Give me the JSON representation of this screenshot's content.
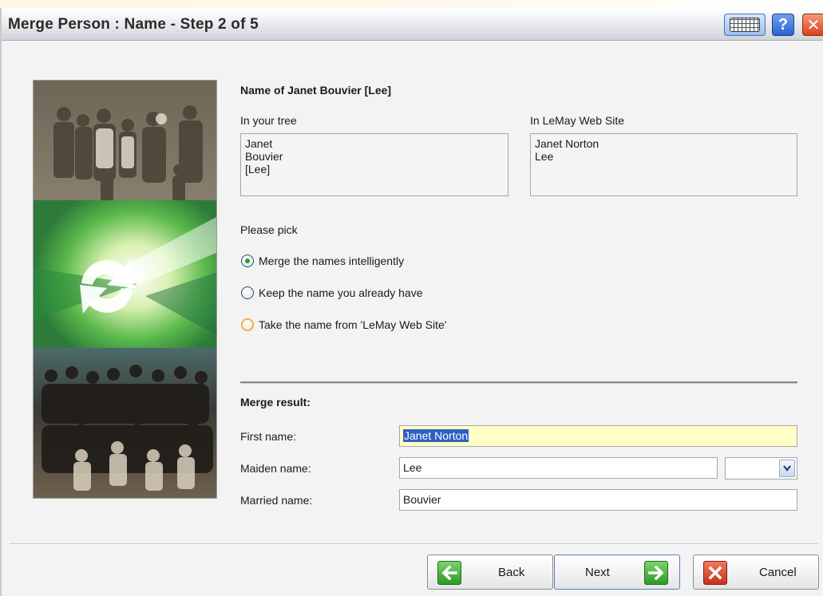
{
  "window": {
    "title": "Merge Person : Name - Step 2 of 5"
  },
  "titlebar_buttons": {
    "keyboard_icon": "keyboard-icon",
    "help_label": "?",
    "close_label": "✕"
  },
  "heading": "Name of Janet Bouvier [Lee]",
  "tree": {
    "label": "In your tree",
    "lines": [
      "Janet",
      "Bouvier",
      "[Lee]"
    ]
  },
  "site": {
    "label": "In LeMay Web Site",
    "lines": [
      "Janet Norton",
      "Lee"
    ]
  },
  "pick": {
    "label": "Please pick",
    "options": [
      {
        "label": "Merge the names intelligently",
        "checked": true
      },
      {
        "label": "Keep the name you already have",
        "checked": false
      },
      {
        "label": "Take the name from 'LeMay Web Site'",
        "checked": false
      }
    ]
  },
  "result": {
    "label": "Merge result:",
    "first_name_label": "First name:",
    "first_name_value": "Janet Norton",
    "maiden_name_label": "Maiden name:",
    "maiden_name_value": "Lee",
    "maiden_dropdown_value": "",
    "married_name_label": "Married name:",
    "married_name_value": "Bouvier"
  },
  "buttons": {
    "back": "Back",
    "next": "Next",
    "cancel": "Cancel"
  },
  "colors": {
    "accent_green": "#2e9a2a",
    "cancel_red": "#c5321a",
    "highlight_field": "#ffffc6"
  }
}
